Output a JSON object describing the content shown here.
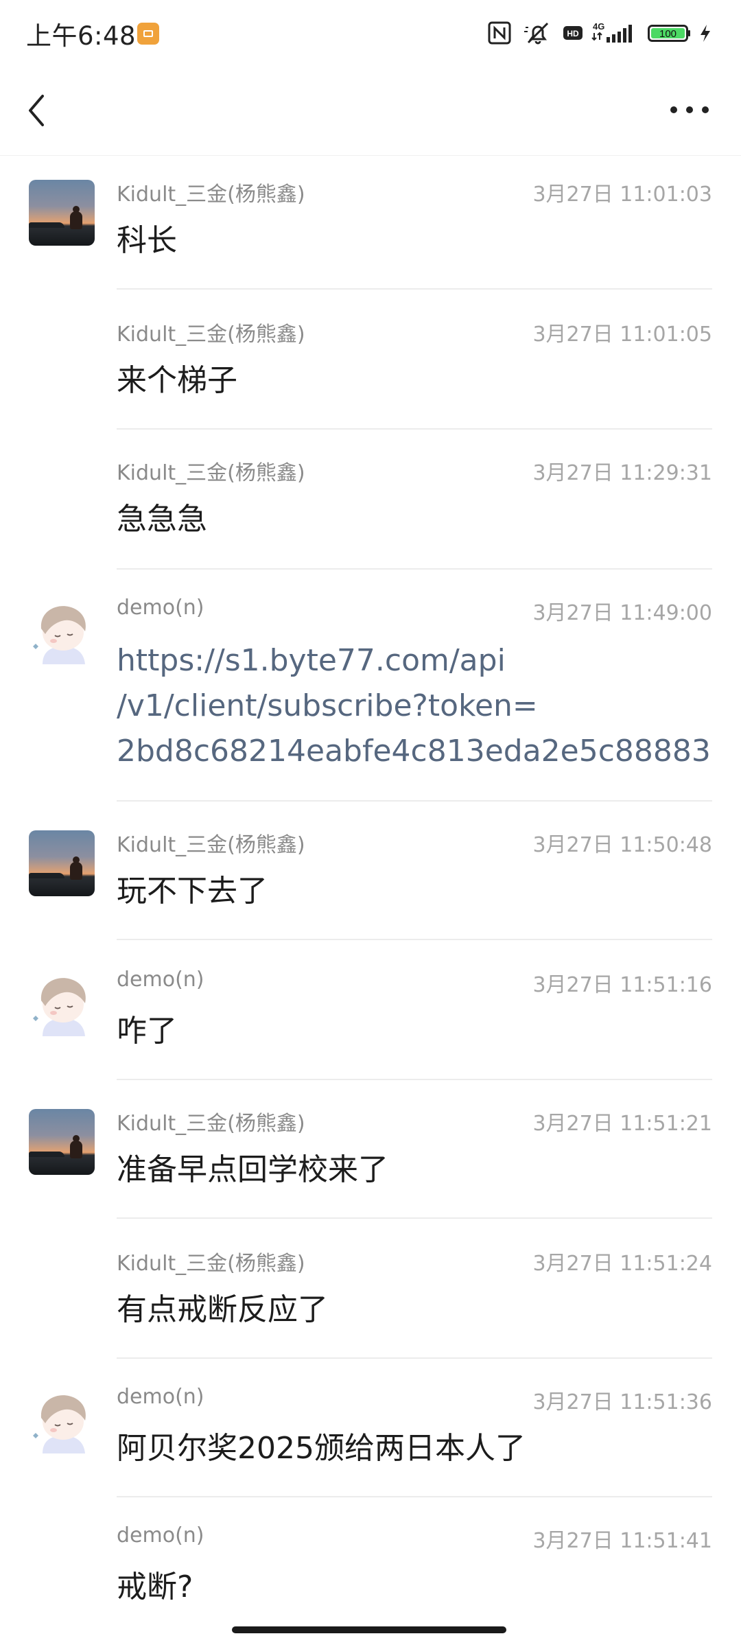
{
  "status_bar": {
    "time": "上午6:48",
    "battery": "100"
  },
  "nav": {
    "back_icon": "chevron-left-icon",
    "more_icon": "more-horizontal-icon"
  },
  "messages": [
    {
      "sender": "Kidult_三金(杨熊鑫)",
      "time": "3月27日 11:01:03",
      "text": "科长",
      "avatar": "sunset-photo"
    },
    {
      "sender": "Kidult_三金(杨熊鑫)",
      "time": "3月27日 11:01:05",
      "text": "来个梯子"
    },
    {
      "sender": "Kidult_三金(杨熊鑫)",
      "time": "3月27日 11:29:31",
      "text": "急急急"
    },
    {
      "sender": "demo(n)",
      "time": "3月27日 11:49:00",
      "avatar": "cartoon-boy",
      "link_lines": [
        "https://s1.byte77.com/api",
        "/v1/client/subscribe?token=",
        "2bd8c68214eabfe4c813eda2e5c88883"
      ]
    },
    {
      "sender": "Kidult_三金(杨熊鑫)",
      "time": "3月27日 11:50:48",
      "text": "玩不下去了",
      "avatar": "sunset-photo"
    },
    {
      "sender": "demo(n)",
      "time": "3月27日 11:51:16",
      "text": "咋了",
      "avatar": "cartoon-boy"
    },
    {
      "sender": "Kidult_三金(杨熊鑫)",
      "time": "3月27日 11:51:21",
      "text": "准备早点回学校来了",
      "avatar": "sunset-photo"
    },
    {
      "sender": "Kidult_三金(杨熊鑫)",
      "time": "3月27日 11:51:24",
      "text": "有点戒断反应了"
    },
    {
      "sender": "demo(n)",
      "time": "3月27日 11:51:36",
      "text": "阿贝尔奖2025颁给两日本人了",
      "avatar": "cartoon-boy"
    },
    {
      "sender": "demo(n)",
      "time": "3月27日 11:51:41",
      "text": "戒断?"
    }
  ],
  "colors": {
    "link": "#56677f",
    "meta": "#a6a6a6",
    "divider": "#ececec"
  }
}
